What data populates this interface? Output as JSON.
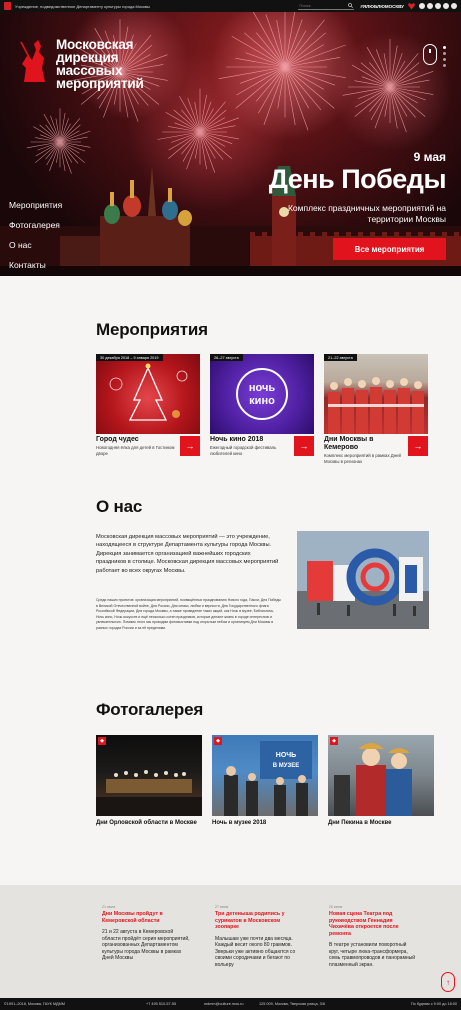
{
  "topbar": {
    "org_text": "Учреждение, подведомственное Департаменту культуры города Москвы",
    "search_placeholder": "Поиск",
    "hashtag": "#ЯЛЮБЛЮМОСКВУ"
  },
  "hero": {
    "logo_lines": [
      "Московская",
      "дирекция",
      "массовых",
      "мероприятий"
    ],
    "date": "9 мая",
    "title": "День Победы",
    "subtitle": "Комплекс праздничных мероприятий на территории Москвы",
    "cta": "Все мероприятия",
    "nav": [
      "Мероприятия",
      "Фотогалерея",
      "О нас",
      "Контакты"
    ]
  },
  "events": {
    "heading": "Мероприятия",
    "items": [
      {
        "date": "30 декабря 2018 – 9 января 2019",
        "name": "Город чудес",
        "desc": "Новогодняя ёлка для детей в Гостином дворе"
      },
      {
        "date": "26–27 августа",
        "name": "Ночь кино 2018",
        "desc": "Ежегодный городской фестиваль любителей кино"
      },
      {
        "date": "21–22 августа",
        "name": "Дни Москвы в Кемерово",
        "desc": "Комплекс мероприятий в рамках Дней Москвы в регионах"
      }
    ],
    "image_texts": [
      "ночь",
      "кино"
    ]
  },
  "about": {
    "heading": "О нас",
    "lead": "Московская дирекция массовых мероприятий — это учреждение, находящееся в структуре Департамента культуры города Москвы. Дирекция занимается организацией важнейших городских праздников в столице. Московская дирекция массовых мероприятий работает во всех округах Москвы.",
    "body": "Среди наших проектов: организация мероприятий, посвящённых празднованию Нового года, Пасхи, Дня Победы в Великой Отечественной войне, Дня России, Дня семьи, любви и верности, Дня Государственного флага Российской Федерации, Дня города Москвы, а также проведение таких акций, как Ночь в музее, Библионочь, Ночь кино, Ночь искусств и ещё несколько сотен праздников, которые делают жизнь в городе интересною и увлекательною. Помимо этого мы проводим фотовыставки под открытым небом и организуем Дни Москвы в разных городах России и за её пределами."
  },
  "gallery": {
    "heading": "Фотогалерея",
    "items": [
      {
        "name": "Дни Орловской области в Москве"
      },
      {
        "name": "Ночь в музее 2018"
      },
      {
        "name": "Дни Пекина в Москве"
      }
    ],
    "image_texts": [
      "НОЧЬ",
      "В МУЗЕЕ"
    ]
  },
  "news": [
    {
      "date": "21 июля",
      "title": "Дни Москвы пройдут в Кемеровской области",
      "body": "21 и 22 августа в Кемеровской области пройдёт серия мероприятий, организованных Департаментом культуры города Москвы в рамках Дней Москвы"
    },
    {
      "date": "27 июля",
      "title": "Три детеныша родились у сурикатов в Московском зоопарке",
      "body": "Малышам уже почти два месяца. Каждый весит около 80 граммов. Зверьки уже активно общаются со своими сородичами и бегают по вольеру"
    },
    {
      "date": "26 июля",
      "title": "Новая сцена Театра под руководством Геннадия Чихачёва откроется после ремонта",
      "body": "В театре установили поворотный круг, четыре люка-трансформера, семь травмопроводов и панорамный плазменный экран."
    }
  ],
  "footer": {
    "copyright": "©1991–2018, Москва, ГАУК МДММ",
    "phone": "+7 495 510-57-55",
    "email": "mdmm@culture.mos.ru",
    "address": "125 009, Москва, Тверская улица, 3/6",
    "hours": "По будням с 9:00 до 18:00"
  },
  "colors": {
    "accent": "#e1141d",
    "dark": "#111111",
    "page": "#f6f5f3",
    "news_bg": "#e4e3df"
  },
  "icons": [
    "emblem-icon",
    "heart-icon",
    "social-icons",
    "mouse-scroll-icon",
    "arrow-right-icon",
    "arrow-up-icon"
  ]
}
